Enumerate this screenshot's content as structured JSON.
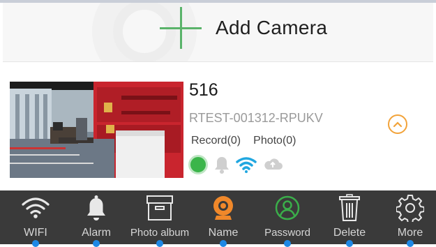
{
  "header": {
    "add_label": "Add Camera",
    "accent": "#5ab36a"
  },
  "camera": {
    "name": "516",
    "id": "RTEST-001312-RPUKV",
    "record_label": "Record(0)",
    "photo_label": "Photo(0)",
    "online_color": "#3bb54a",
    "status_icons": [
      "online-dot-icon",
      "bell-icon",
      "wifi-icon",
      "cloud-icon"
    ]
  },
  "toolbar": {
    "items": [
      {
        "label": "WIFI",
        "icon": "wifi-icon"
      },
      {
        "label": "Alarm",
        "icon": "bell-icon"
      },
      {
        "label": "Photo album",
        "icon": "archive-box-icon"
      },
      {
        "label": "Name",
        "icon": "camera-lens-icon"
      },
      {
        "label": "Password",
        "icon": "user-icon"
      },
      {
        "label": "Delete",
        "icon": "trash-icon"
      },
      {
        "label": "More",
        "icon": "gear-icon"
      }
    ]
  }
}
